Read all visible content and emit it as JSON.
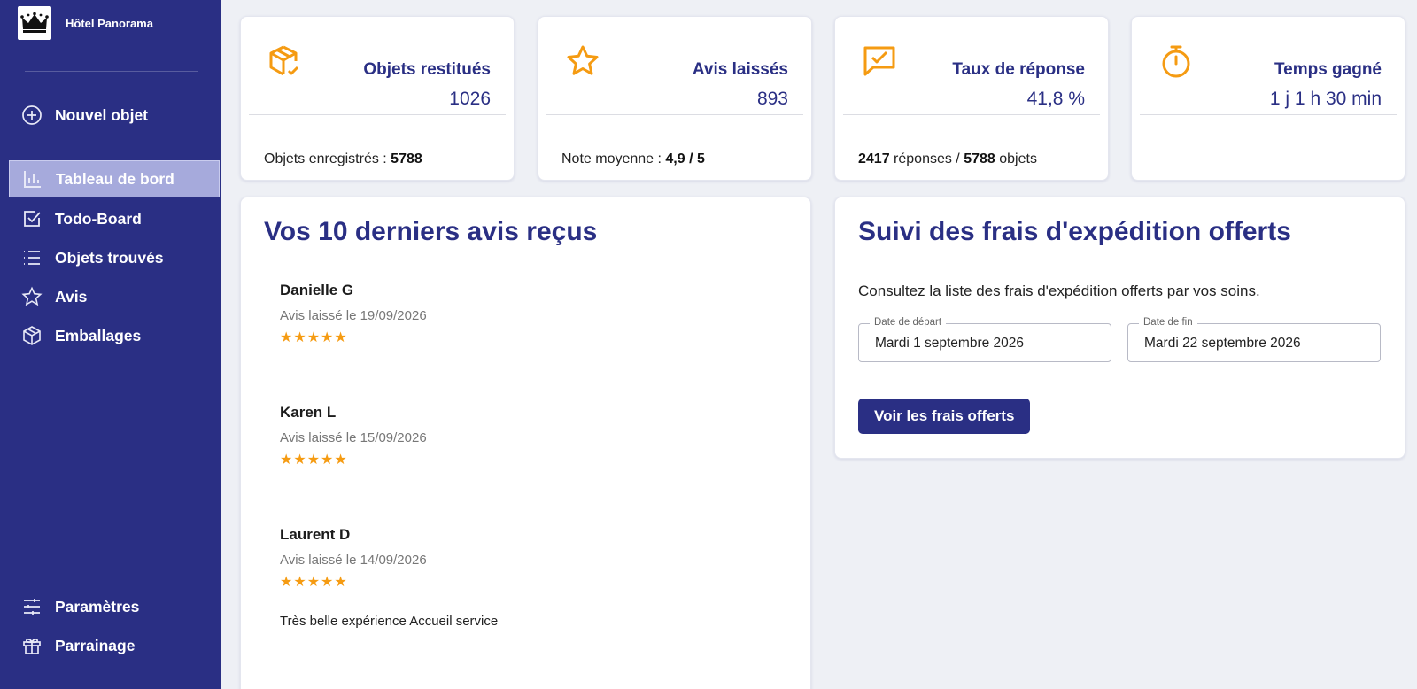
{
  "brand": {
    "name": "Hôtel Panorama"
  },
  "nav": {
    "new_item": "Nouvel objet",
    "dashboard": "Tableau de bord",
    "todo": "Todo-Board",
    "found": "Objets trouvés",
    "reviews": "Avis",
    "packaging": "Emballages",
    "settings": "Paramètres",
    "referral": "Parrainage"
  },
  "stats": [
    {
      "title": "Objets restitués",
      "value": "1026",
      "foot_label": "Objets enregistrés : ",
      "foot_value": "5788",
      "icon": "package-check-icon"
    },
    {
      "title": "Avis laissés",
      "value": "893",
      "foot_label": "Note moyenne : ",
      "foot_value": "4,9 / 5",
      "icon": "star-icon"
    },
    {
      "title": "Taux de réponse",
      "value": "41,8 %",
      "foot_a": "2417",
      "foot_b": " réponses / ",
      "foot_c": "5788",
      "foot_d": " objets",
      "icon": "message-check-icon"
    },
    {
      "title": "Temps gagné",
      "value": "1 j 1 h 30 min",
      "icon": "stopwatch-icon"
    }
  ],
  "reviews": {
    "title": "Vos 10 derniers avis reçus",
    "items": [
      {
        "name": "Danielle G",
        "date": "Avis laissé le 19/09/2026",
        "stars": "★★★★★",
        "rating": 5
      },
      {
        "name": "Karen L",
        "date": "Avis laissé le 15/09/2026",
        "stars": "★★★★★",
        "rating": 5
      },
      {
        "name": "Laurent D",
        "date": "Avis laissé le 14/09/2026",
        "stars": "★★★★★",
        "rating": 5,
        "text": "Très belle expérience Accueil service"
      }
    ]
  },
  "shipping": {
    "title": "Suivi des frais d'expédition offerts",
    "description": "Consultez la liste des frais d'expédition offerts par vos soins.",
    "start_label": "Date de départ",
    "start_value": "Mardi 1 septembre 2026",
    "end_label": "Date de fin",
    "end_value": "Mardi 22 septembre 2026",
    "button": "Voir les frais offerts"
  },
  "colors": {
    "primary": "#2a2f84",
    "accent": "#f59b12",
    "background": "#eef0f5"
  }
}
